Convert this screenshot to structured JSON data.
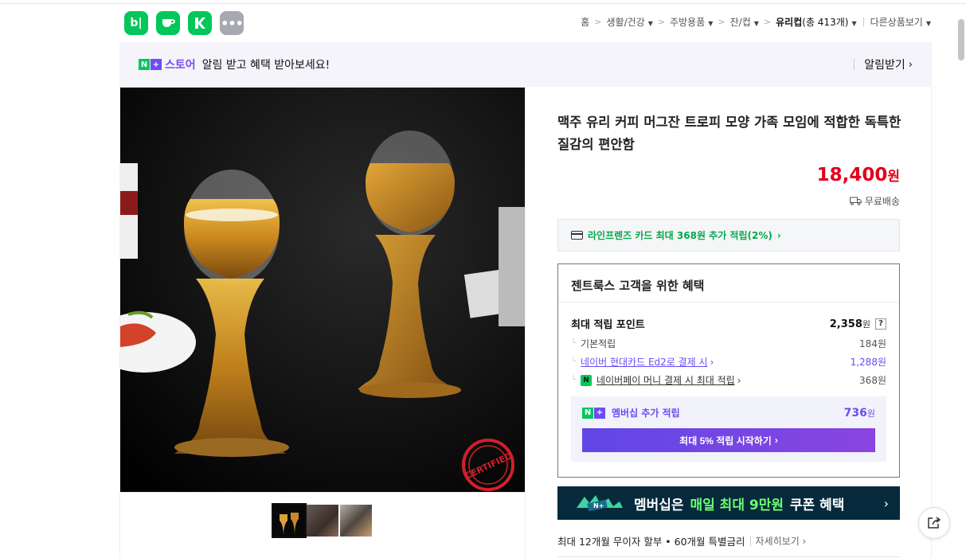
{
  "apps": [
    {
      "name": "blog-app-icon",
      "glyph": "b|"
    },
    {
      "name": "cafe-app-icon",
      "glyph": "☕"
    },
    {
      "name": "kin-app-icon",
      "glyph": "K"
    },
    {
      "name": "more-apps-icon",
      "glyph": "•••"
    }
  ],
  "breadcrumb": {
    "home": "홈",
    "items": [
      "생활/건강",
      "주방용품",
      "잔/컵"
    ],
    "current_name": "유리컵",
    "current_count": "(총 413개)",
    "other": "다른상품보기"
  },
  "banner": {
    "badge_n": "N",
    "badge_plus": "+",
    "store": "스토어",
    "message": "알림 받고 혜택 받아보세요!",
    "action": "알림받기"
  },
  "product": {
    "title": "맥주 유리 커피 머그잔 트로피 모양 가족 모임에 적합한 독특한 질감의 편안함",
    "price": "18,400",
    "price_unit": "원",
    "shipping": "무료배송",
    "image_badge": "CERTIFIED"
  },
  "card_offer": {
    "text": "라인프렌즈 카드 최대 368원 추가 적립(2%)"
  },
  "benefits": {
    "title": "젠트룩스 고객을 위한 혜택",
    "max_points_label": "최대 적립 포인트",
    "max_points_value": "2,358",
    "unit": "원",
    "help": "?",
    "basic_label": "기본적립",
    "basic_value": "184원",
    "card_label": "네이버 현대카드 Ed2로 결제 시",
    "card_value": "1,288원",
    "npay_label": "네이버페이 머니 결제 시 최대 적립",
    "npay_value": "368원",
    "npay_badge": "N",
    "member_label": "멤버십 추가 적립",
    "member_value": "736",
    "member_cta": "최대 5% 적립 시작하기"
  },
  "promo": {
    "prefix": "멤버십은",
    "highlight": "매일 최대 9만원",
    "suffix": "쿠폰 혜택"
  },
  "installment": {
    "text": "최대 12개월 무이자 할부 • 60개월 특별금리",
    "more": "자세히보기"
  }
}
